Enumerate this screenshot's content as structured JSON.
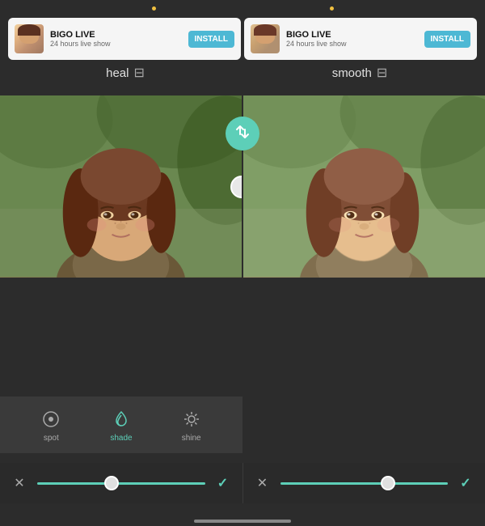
{
  "dots": [
    {
      "id": "dot1"
    },
    {
      "id": "dot2"
    }
  ],
  "ads": [
    {
      "id": "ad-left",
      "title": "BIGO LIVE",
      "subtitle": "24 hours live show",
      "install_label": "INSTALL"
    },
    {
      "id": "ad-right",
      "title": "BIGO LIVE",
      "subtitle": "24 hours live show",
      "install_label": "INSTALL"
    }
  ],
  "filters": {
    "left_label": "heal",
    "right_label": "smooth",
    "swap_icon": "⇄"
  },
  "tools": [
    {
      "id": "spot",
      "label": "spot",
      "icon": "⊙",
      "active": false
    },
    {
      "id": "shade",
      "label": "shade",
      "icon": "☽",
      "active": true
    },
    {
      "id": "shine",
      "label": "shine",
      "icon": "✺",
      "active": false
    }
  ],
  "sliders": {
    "left": {
      "cancel_label": "✕",
      "confirm_label": "✓",
      "thumb_position_pct": 42
    },
    "right": {
      "cancel_label": "✕",
      "confirm_label": "✓",
      "thumb_position_pct": 62
    }
  },
  "colors": {
    "accent": "#5dcfb8",
    "bg": "#2c2c2c",
    "panel": "#3a3a3a",
    "ad_btn": "#4db8d4",
    "text_light": "#e0e0e0",
    "text_muted": "#aaa"
  }
}
